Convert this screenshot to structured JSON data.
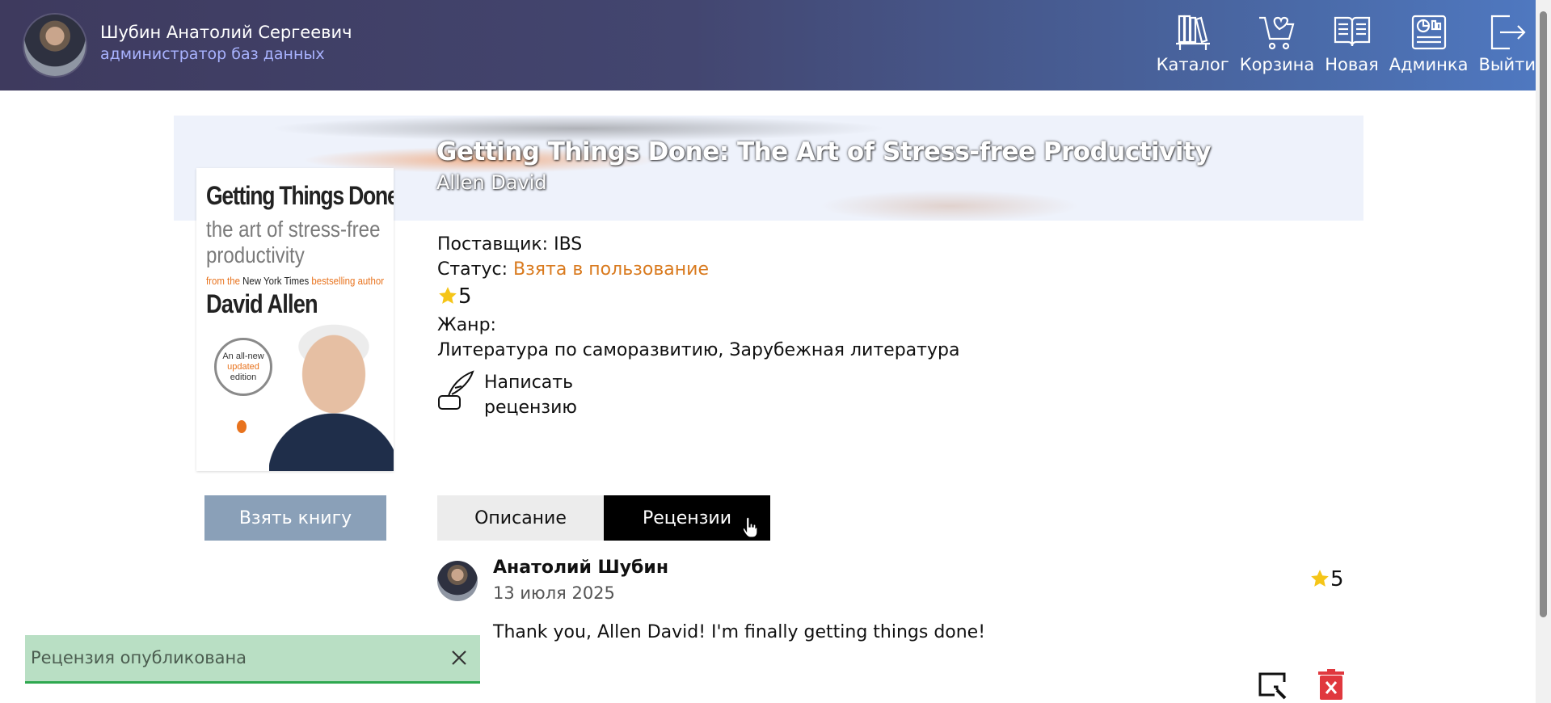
{
  "user": {
    "name": "Шубин Анатолий Сергеевич",
    "role": "администратор баз данных"
  },
  "nav": [
    {
      "label": "Каталог",
      "icon": "bookshelf-icon"
    },
    {
      "label": "Корзина",
      "icon": "cart-heart-icon"
    },
    {
      "label": "Новая",
      "icon": "open-book-icon"
    },
    {
      "label": "Админка",
      "icon": "dashboard-icon"
    },
    {
      "label": "Выйти",
      "icon": "logout-icon"
    }
  ],
  "book": {
    "title": "Getting Things Done: The Art of Stress-free Productivity",
    "author": "Allen David",
    "cover": {
      "title": "Getting Things Done",
      "subtitle_line1": "the art of stress-free",
      "subtitle_line2": "productivity",
      "from_prefix": "from the ",
      "from_nyt": "New York Times",
      "from_suffix": " bestselling author",
      "author": "David Allen",
      "badge_line1": "An all-new",
      "badge_line2": "updated",
      "badge_line3": "edition"
    },
    "supplier_label": "Поставщик:",
    "supplier": "IBS",
    "status_label": "Статус:",
    "status": "Взята в пользование",
    "rating": "5",
    "genre_label": "Жанр:",
    "genres": "Литература по саморазвитию, Зарубежная литература"
  },
  "actions": {
    "write_review_line1": "Написать",
    "write_review_line2": "рецензию",
    "take_book": "Взять книгу"
  },
  "tabs": {
    "description": "Описание",
    "reviews": "Рецензии",
    "active": "reviews"
  },
  "review": {
    "author": "Анатолий Шубин",
    "date": "13 июля 2025",
    "rating": "5",
    "text": "Thank you, Allen David! I'm finally getting things done!"
  },
  "toast": {
    "message": "Рецензия опубликована"
  },
  "colors": {
    "header_start": "#3e3a5e",
    "header_end": "#4f78c0",
    "status": "#d97a1e",
    "star": "#f5c518",
    "toast_bg": "#b9dfc4",
    "toast_border": "#2ea84f",
    "delete": "#e0383e"
  }
}
